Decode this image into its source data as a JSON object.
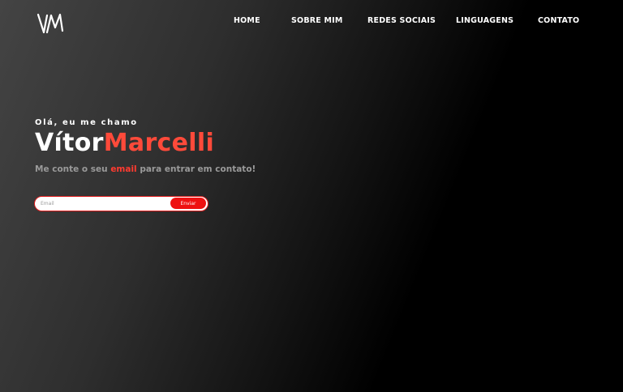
{
  "logo": {
    "text": "VM",
    "icon": "vm-logo-icon"
  },
  "nav": {
    "items": [
      {
        "label": "HOME"
      },
      {
        "label": "SOBRE MIM"
      },
      {
        "label": "REDES SOCIAIS"
      },
      {
        "label": "LINGUAGENS"
      },
      {
        "label": "CONTATO"
      }
    ]
  },
  "hero": {
    "greeting": "Olá, eu me chamo",
    "first_name": "Vítor",
    "last_name": "Marcelli",
    "contact_prefix": "Me conte o seu ",
    "contact_highlight": "email",
    "contact_suffix": " para entrar em contato!"
  },
  "form": {
    "email_placeholder": "Email",
    "email_value": "",
    "submit_label": "Enviar"
  },
  "colors": {
    "accent": "#ff4a3a",
    "button": "#ee1111",
    "background_dark": "#000000",
    "background_light": "#444444"
  }
}
